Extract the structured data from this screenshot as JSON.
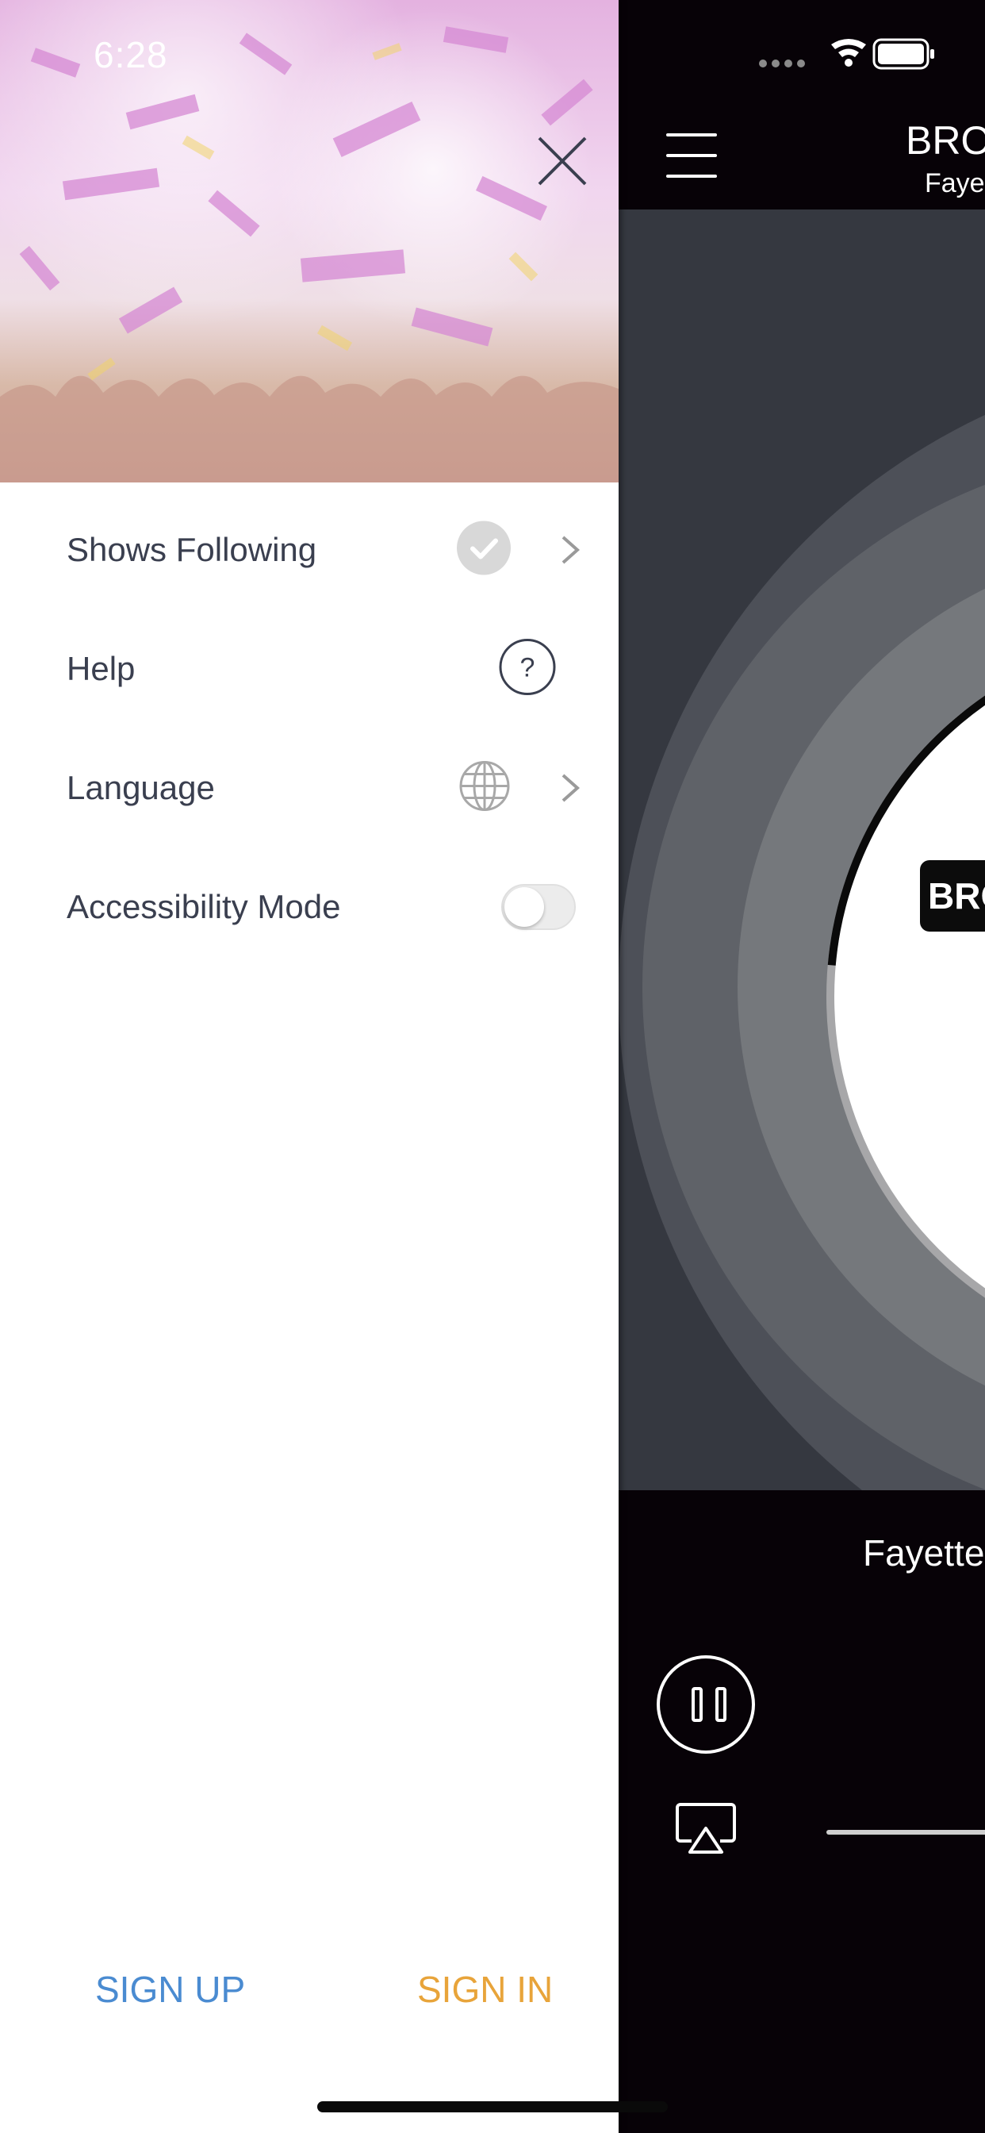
{
  "status_bar": {
    "time": "6:28"
  },
  "drawer": {
    "items": [
      {
        "label": "Shows Following",
        "icon": "check-circle-icon",
        "chevron": true
      },
      {
        "label": "Help",
        "icon": "question-circle-icon",
        "chevron": false
      },
      {
        "label": "Language",
        "icon": "globe-icon",
        "chevron": true
      },
      {
        "label": "Accessibility Mode",
        "icon": "toggle",
        "toggle_on": false
      }
    ],
    "sign_up_label": "SIGN UP",
    "sign_in_label": "SIGN IN"
  },
  "player": {
    "title": "BRO",
    "subtitle": "Faye",
    "logo_text": "BRO",
    "now_playing": "Fayette"
  },
  "colors": {
    "sign_up": "#4a8bd1",
    "sign_in": "#e8a43a",
    "menu_text": "#3a3f4f",
    "player_bg": "#070207"
  }
}
